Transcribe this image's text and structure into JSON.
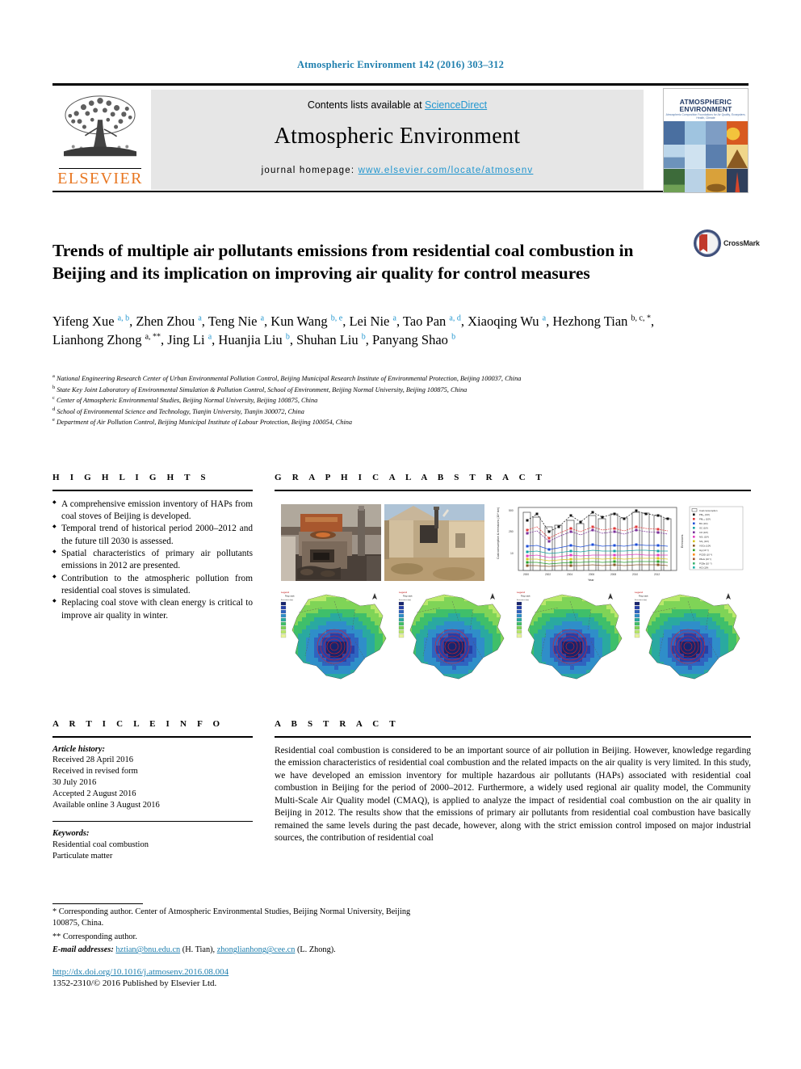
{
  "running_head": "Atmospheric Environment 142 (2016) 303–312",
  "masthead": {
    "contents_prefix": "Contents lists available at ",
    "contents_link": "ScienceDirect",
    "journal_title": "Atmospheric Environment",
    "homepage_prefix": "journal homepage: ",
    "homepage_url": "www.elsevier.com/locate/atmosenv",
    "publisher_logo_text": "ELSEVIER",
    "cover": {
      "title_line1": "ATMOSPHERIC",
      "title_line2": "ENVIRONMENT",
      "subtitle": "Atmospheric Composition Foundations for Air Quality, Ecosystem, Health, Climate"
    }
  },
  "article": {
    "title": "Trends of multiple air pollutants emissions from residential coal combustion in Beijing and its implication on improving air quality for control measures",
    "crossmark_label": "CrossMark",
    "authors": [
      {
        "name": "Yifeng Xue",
        "sup": "a, b",
        "sep": ", "
      },
      {
        "name": "Zhen Zhou",
        "sup": "a",
        "sep": ", "
      },
      {
        "name": "Teng Nie",
        "sup": "a",
        "sep": ", "
      },
      {
        "name": "Kun Wang",
        "sup": "b, e",
        "sep": ", "
      },
      {
        "name": "Lei Nie",
        "sup": "a",
        "sep": ", "
      },
      {
        "name": "Tao Pan",
        "sup": "a, d",
        "sep": ", "
      },
      {
        "name": "Xiaoqing Wu",
        "sup": "a",
        "sep": ", "
      },
      {
        "name": "Hezhong Tian",
        "sup": "b, c, *",
        "sep": ", "
      },
      {
        "name": "Lianhong Zhong",
        "sup": "a, **",
        "sep": ", "
      },
      {
        "name": "Jing Li",
        "sup": "a",
        "sep": ", "
      },
      {
        "name": "Huanjia Liu",
        "sup": "b",
        "sep": ", "
      },
      {
        "name": "Shuhan Liu",
        "sup": "b",
        "sep": ", "
      },
      {
        "name": "Panyang Shao",
        "sup": "b",
        "sep": ""
      }
    ],
    "affiliations": [
      {
        "label": "a",
        "text": "National Engineering Research Center of Urban Environmental Pollution Control, Beijing Municipal Research Institute of Environmental Protection, Beijing 100037, China"
      },
      {
        "label": "b",
        "text": "State Key Joint Laboratory of Environmental Simulation & Pollution Control, School of Environment, Beijing Normal University, Beijing 100875, China"
      },
      {
        "label": "c",
        "text": "Center of Atmospheric Environmental Studies, Beijing Normal University, Beijing 100875, China"
      },
      {
        "label": "d",
        "text": "School of Environmental Science and Technology, Tianjin University, Tianjin 300072, China"
      },
      {
        "label": "e",
        "text": "Department of Air Pollution Control, Beijing Municipal Institute of Labour Protection, Beijing 100054, China"
      }
    ]
  },
  "highlights": {
    "heading": "H I G H L I G H T S",
    "items": [
      "A comprehensive emission inventory of HAPs from coal stoves of Beijing is developed.",
      "Temporal trend of historical period 2000–2012 and the future till 2030 is assessed.",
      "Spatial characteristics of primary air pollutants emissions in 2012 are presented.",
      "Contribution to the atmospheric pollution from residential coal stoves is simulated.",
      "Replacing coal stove with clean energy is critical to improve air quality in winter."
    ]
  },
  "graphical_abstract": {
    "heading": "G R A P H I C A L   A B S T R A C T",
    "panels": [
      {
        "name": "coal-stove-photo",
        "caption": ""
      },
      {
        "name": "courtyard-photo",
        "caption": ""
      },
      {
        "name": "emission-trend-chart",
        "caption": ""
      },
      {
        "name": "beijing-emission-map-1",
        "caption": ""
      },
      {
        "name": "beijing-emission-map-2",
        "caption": ""
      },
      {
        "name": "beijing-emission-map-3",
        "caption": ""
      },
      {
        "name": "beijing-emission-map-4",
        "caption": ""
      }
    ]
  },
  "chart_data": {
    "type": "line",
    "title": "",
    "xlabel": "Year",
    "ylabel": "Coal consumption & emissions (10⁴ ton)",
    "ylabel_right": "Emissions",
    "categories": [
      "2000",
      "2002",
      "2004",
      "2006",
      "2008",
      "2010",
      "2012"
    ],
    "bars": {
      "name": "Coal consumption",
      "values": [
        490,
        390,
        430,
        455,
        470,
        480,
        440
      ]
    },
    "series": [
      {
        "name": "PM10 (10²)",
        "values": [
          0.78,
          0.62,
          0.7,
          0.74,
          0.76,
          0.78,
          0.72
        ]
      },
      {
        "name": "PM2.5 (10²)",
        "values": [
          0.52,
          0.41,
          0.47,
          0.49,
          0.51,
          0.52,
          0.48
        ]
      },
      {
        "name": "BC (10¹)",
        "values": [
          0.3,
          0.24,
          0.27,
          0.29,
          0.3,
          0.3,
          0.28
        ]
      },
      {
        "name": "OC (10¹)",
        "values": [
          0.29,
          0.23,
          0.26,
          0.28,
          0.29,
          0.29,
          0.27
        ]
      },
      {
        "name": "CO (10³)",
        "values": [
          0.22,
          0.18,
          0.2,
          0.21,
          0.22,
          0.22,
          0.21
        ]
      },
      {
        "name": "NOx (10²)",
        "values": [
          0.18,
          0.14,
          0.16,
          0.17,
          0.18,
          0.18,
          0.17
        ]
      },
      {
        "name": "SO2 (10²)",
        "values": [
          0.16,
          0.13,
          0.15,
          0.15,
          0.16,
          0.16,
          0.15
        ]
      },
      {
        "name": "VOCs (10²)",
        "values": [
          0.13,
          0.1,
          0.12,
          0.12,
          0.13,
          0.13,
          0.12
        ]
      },
      {
        "name": "Hg (10⁻²)",
        "values": [
          0.1,
          0.08,
          0.09,
          0.1,
          0.1,
          0.1,
          0.09
        ]
      },
      {
        "name": "PCDD (10⁻³)",
        "values": [
          0.08,
          0.06,
          0.07,
          0.08,
          0.08,
          0.08,
          0.07
        ]
      },
      {
        "name": "PAHs (10⁻¹)",
        "values": [
          0.06,
          0.05,
          0.06,
          0.06,
          0.06,
          0.06,
          0.06
        ]
      },
      {
        "name": "PCBs (10⁻⁴)",
        "values": [
          0.05,
          0.04,
          0.04,
          0.05,
          0.05,
          0.05,
          0.04
        ]
      },
      {
        "name": "HCl (10¹)",
        "values": [
          0.04,
          0.03,
          0.03,
          0.04,
          0.04,
          0.04,
          0.03
        ]
      }
    ],
    "grid": false,
    "legend_position": "right"
  },
  "article_info": {
    "heading": "A R T I C L E   I N F O",
    "history_label": "Article history:",
    "history": [
      "Received 28 April 2016",
      "Received in revised form",
      "30 July 2016",
      "Accepted 2 August 2016",
      "Available online 3 August 2016"
    ],
    "keywords_label": "Keywords:",
    "keywords": [
      "Residential coal combustion",
      "Particulate matter"
    ]
  },
  "abstract": {
    "heading": "A B S T R A C T",
    "text": "Residential coal combustion is considered to be an important source of air pollution in Beijing. However, knowledge regarding the emission characteristics of residential coal combustion and the related impacts on the air quality is very limited. In this study, we have developed an emission inventory for multiple hazardous air pollutants (HAPs) associated with residential coal combustion in Beijing for the period of 2000–2012. Furthermore, a widely used regional air quality model, the Community Multi-Scale Air Quality model (CMAQ), is applied to analyze the impact of residential coal combustion on the air quality in Beijing in 2012. The results show that the emissions of primary air pollutants from residential coal combustion have basically remained the same levels during the past decade, however, along with the strict emission control imposed on major industrial sources, the contribution of residential coal"
  },
  "footer": {
    "corresponding_1": "* Corresponding author. Center of Atmospheric Environmental Studies, Beijing Normal University, Beijing 100875, China.",
    "corresponding_2": "** Corresponding author.",
    "email_label": "E-mail addresses:",
    "email_1": "hztian@bnu.edu.cn",
    "email_1_owner": "(H. Tian),",
    "email_2": "zhonglianhong@cee.cn",
    "email_2_owner": "(L. Zhong).",
    "doi": "http://dx.doi.org/10.1016/j.atmosenv.2016.08.004",
    "issn_line": "1352-2310/© 2016 Published by Elsevier Ltd."
  },
  "colors": {
    "link": "#2196cf",
    "heading_blue": "#1f7fae",
    "elsevier_orange": "#e87722",
    "band_gray": "#e6e6e6"
  }
}
